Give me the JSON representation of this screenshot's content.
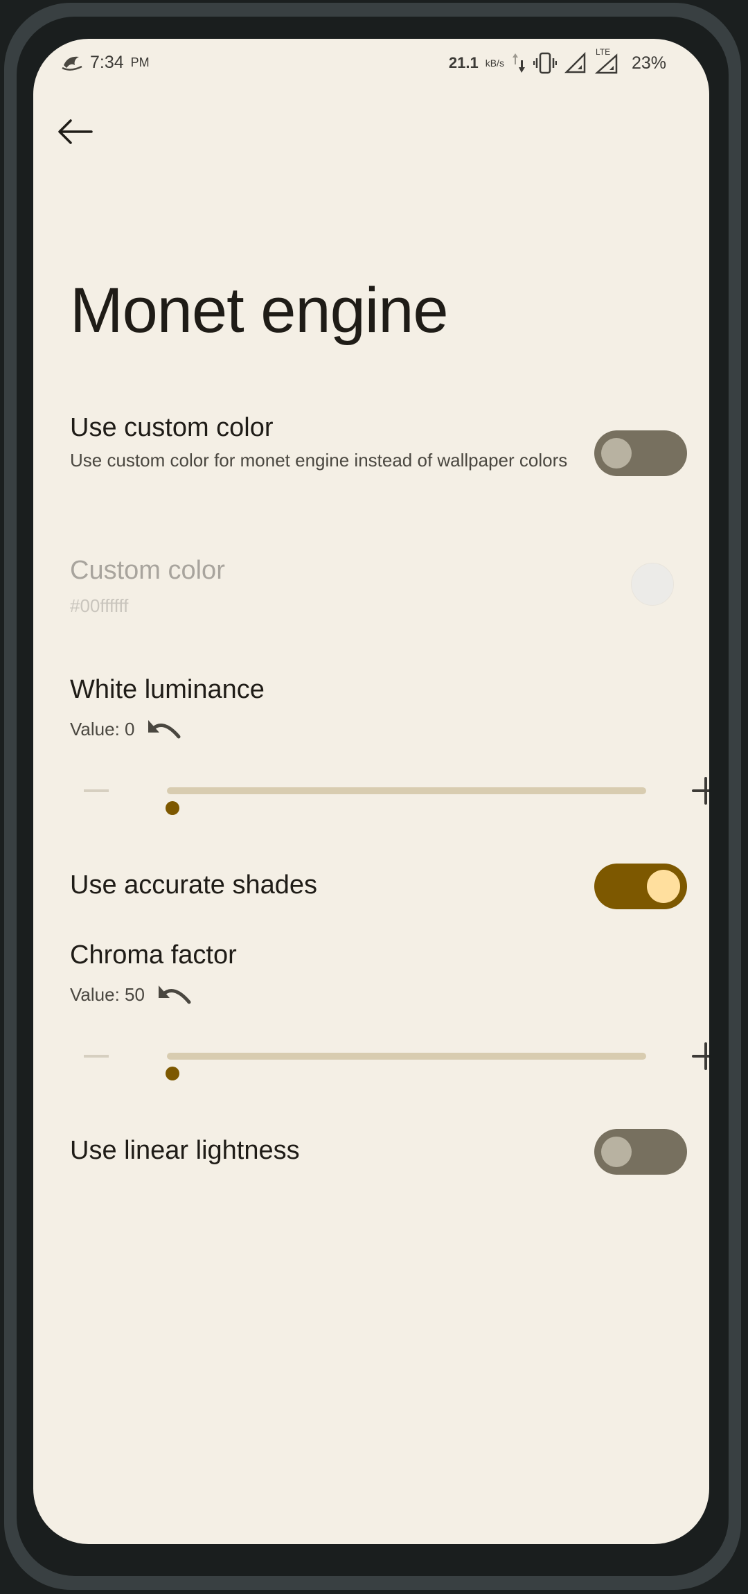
{
  "status_bar": {
    "time": "7:34",
    "ampm": "PM",
    "net_speed": "21.1",
    "net_unit": "kB/s",
    "signal_label": "LTE",
    "battery": "23%",
    "icons": [
      "app-logo-icon",
      "data-transfer-icon",
      "vibrate-icon",
      "signal-icon",
      "lte-signal-icon"
    ]
  },
  "header": {
    "back_icon": "back-arrow-icon",
    "title": "Monet engine"
  },
  "settings": {
    "custom_color_toggle": {
      "title": "Use custom color",
      "subtitle": "Use custom color for monet engine instead of wallpaper colors",
      "enabled": false
    },
    "custom_color": {
      "title": "Custom color",
      "value": "#00ffffff",
      "swatch_color": "#ecebe8"
    },
    "white_luminance": {
      "title": "White luminance",
      "value_label": "Value: 0",
      "value": 0,
      "level": 0.0
    },
    "accurate_shades": {
      "title": "Use accurate shades",
      "enabled": true
    },
    "chroma_factor": {
      "title": "Chroma factor",
      "value_label": "Value: 50",
      "value": 50,
      "level": 0.0
    },
    "linear_lightness": {
      "title": "Use linear lightness",
      "enabled": false
    }
  },
  "colors": {
    "background": "#f4efe5",
    "accent": "#7d5800",
    "switch_on_knob": "#ffdf9e",
    "switch_off_track": "#77705f",
    "slider_track": "#d8ccb0"
  }
}
